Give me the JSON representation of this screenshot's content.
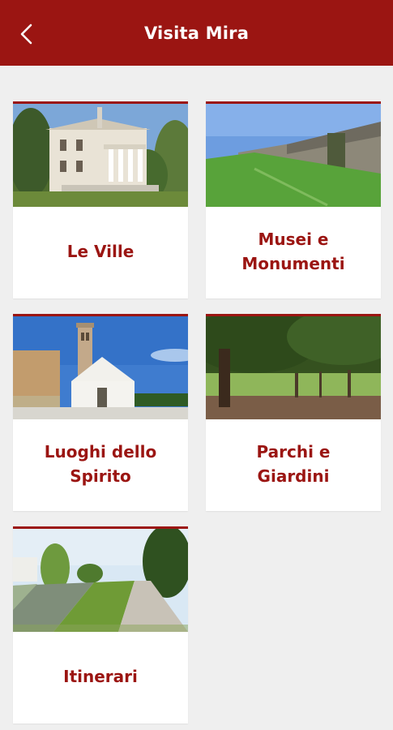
{
  "header": {
    "title": "Visita Mira",
    "back_icon": "chevron-left-icon",
    "background": "#9b1512"
  },
  "cards": [
    {
      "label": "Le Ville"
    },
    {
      "label": "Musei e\nMonumenti"
    },
    {
      "label": "Luoghi dello\nSpirito"
    },
    {
      "label": "Parchi e\nGiardini"
    },
    {
      "label": "Itinerari"
    }
  ],
  "colors": {
    "accent": "#9b1512",
    "background": "#efefef",
    "card": "#ffffff"
  }
}
